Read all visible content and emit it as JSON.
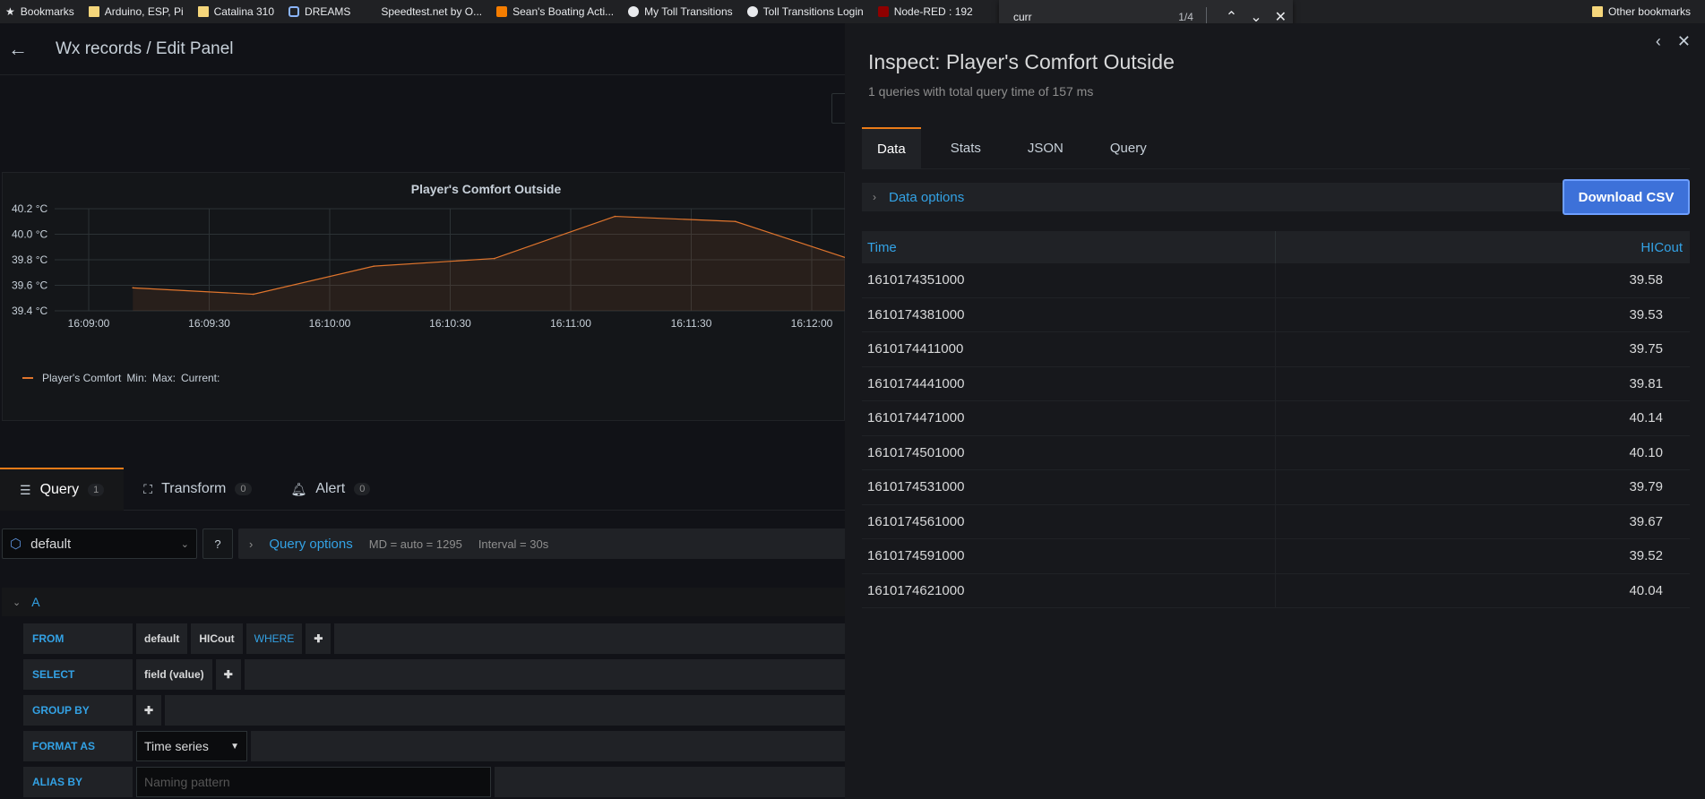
{
  "bookmarks": {
    "items": [
      {
        "label": "Bookmarks",
        "icon": "star-icon"
      },
      {
        "label": "Arduino, ESP, Pi",
        "icon": "folder-icon"
      },
      {
        "label": "Catalina 310",
        "icon": "folder-icon"
      },
      {
        "label": "DREAMS",
        "icon": "site-icon"
      },
      {
        "label": "Speedtest.net by O...",
        "icon": "site-icon"
      },
      {
        "label": "Sean's Boating Acti...",
        "icon": "blogger-icon"
      },
      {
        "label": "My Toll Transitions",
        "icon": "globe-icon"
      },
      {
        "label": "Toll Transitions Login",
        "icon": "globe-icon"
      },
      {
        "label": "Node-RED : 192",
        "icon": "node-red-icon"
      }
    ],
    "other": "Other bookmarks"
  },
  "find": {
    "query": "curr",
    "count": "1/4"
  },
  "editor": {
    "breadcrumb": "Wx records / Edit Panel",
    "panel_title": "Player's Comfort Outside",
    "legend": {
      "series": "Player's Comfort",
      "min": "Min:",
      "max": "Max:",
      "current": "Current:"
    },
    "tabs": [
      {
        "label": "Query",
        "count": "1"
      },
      {
        "label": "Transform",
        "count": "0"
      },
      {
        "label": "Alert",
        "count": "0"
      }
    ],
    "datasource": "default",
    "query_options": {
      "title": "Query options",
      "md": "MD = auto = 1295",
      "interval": "Interval = 30s"
    },
    "query_ref": "A",
    "from": {
      "label": "FROM",
      "db": "default",
      "measurement": "HICout",
      "where": "WHERE"
    },
    "select": {
      "label": "SELECT",
      "field": "field (value)"
    },
    "group_by": {
      "label": "GROUP BY"
    },
    "format_as": {
      "label": "FORMAT AS",
      "value": "Time series"
    },
    "alias_by": {
      "label": "ALIAS BY",
      "placeholder": "Naming pattern"
    }
  },
  "chart_data": {
    "type": "area",
    "title": "Player's Comfort Outside",
    "x_ticks": [
      "16:09:00",
      "16:09:30",
      "16:10:00",
      "16:10:30",
      "16:11:00",
      "16:11:30",
      "16:12:00"
    ],
    "y_ticks": [
      "39.4 °C",
      "39.6 °C",
      "39.8 °C",
      "40.0 °C",
      "40.2 °C"
    ],
    "ylim": [
      39.4,
      40.2
    ],
    "series": [
      {
        "name": "Player's Comfort",
        "color": "#e0752d",
        "x": [
          "16:09:11",
          "16:09:41",
          "16:10:11",
          "16:10:41",
          "16:11:11",
          "16:11:41",
          "16:12:11"
        ],
        "values": [
          39.58,
          39.53,
          39.75,
          39.81,
          40.14,
          40.1,
          39.79
        ]
      }
    ]
  },
  "inspect": {
    "title": "Inspect: Player's Comfort Outside",
    "subtitle": "1 queries with total query time of 157 ms",
    "tabs": [
      "Data",
      "Stats",
      "JSON",
      "Query"
    ],
    "data_options": "Data options",
    "download": "Download CSV",
    "columns": [
      "Time",
      "HICout"
    ],
    "rows": [
      [
        "1610174351000",
        "39.58"
      ],
      [
        "1610174381000",
        "39.53"
      ],
      [
        "1610174411000",
        "39.75"
      ],
      [
        "1610174441000",
        "39.81"
      ],
      [
        "1610174471000",
        "40.14"
      ],
      [
        "1610174501000",
        "40.10"
      ],
      [
        "1610174531000",
        "39.79"
      ],
      [
        "1610174561000",
        "39.67"
      ],
      [
        "1610174591000",
        "39.52"
      ],
      [
        "1610174621000",
        "40.04"
      ]
    ]
  }
}
